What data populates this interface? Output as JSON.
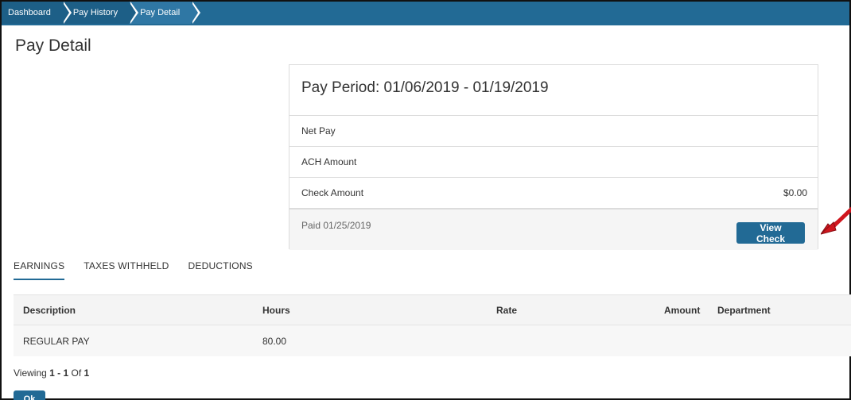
{
  "breadcrumb": [
    "Dashboard",
    "Pay History",
    "Pay Detail"
  ],
  "page_title": "Pay Detail",
  "pay_card": {
    "period_label": "Pay Period: 01/06/2019 - 01/19/2019",
    "rows": [
      {
        "label": "Net Pay",
        "value": ""
      },
      {
        "label": "ACH Amount",
        "value": ""
      },
      {
        "label": "Check Amount",
        "value": "$0.00"
      }
    ],
    "paid_text": "Paid 01/25/2019",
    "view_check_label": "View Check"
  },
  "tabs": [
    "EARNINGS",
    "TAXES WITHHELD",
    "DEDUCTIONS"
  ],
  "active_tab": "EARNINGS",
  "earnings_table": {
    "columns": [
      "Description",
      "Hours",
      "Rate",
      "Amount",
      "Department"
    ],
    "rows": [
      {
        "Description": "REGULAR PAY",
        "Hours": "80.00",
        "Rate": "",
        "Amount": "",
        "Department": ""
      }
    ]
  },
  "viewing": {
    "prefix": "Viewing ",
    "range": "1 - 1",
    "of_label": " Of ",
    "total": "1"
  },
  "bottom_button_label": "Ok",
  "colors": {
    "primary": "#226a95",
    "annotation_arrow": "#d0161e"
  },
  "icons": [
    "annotation-arrow-icon"
  ]
}
